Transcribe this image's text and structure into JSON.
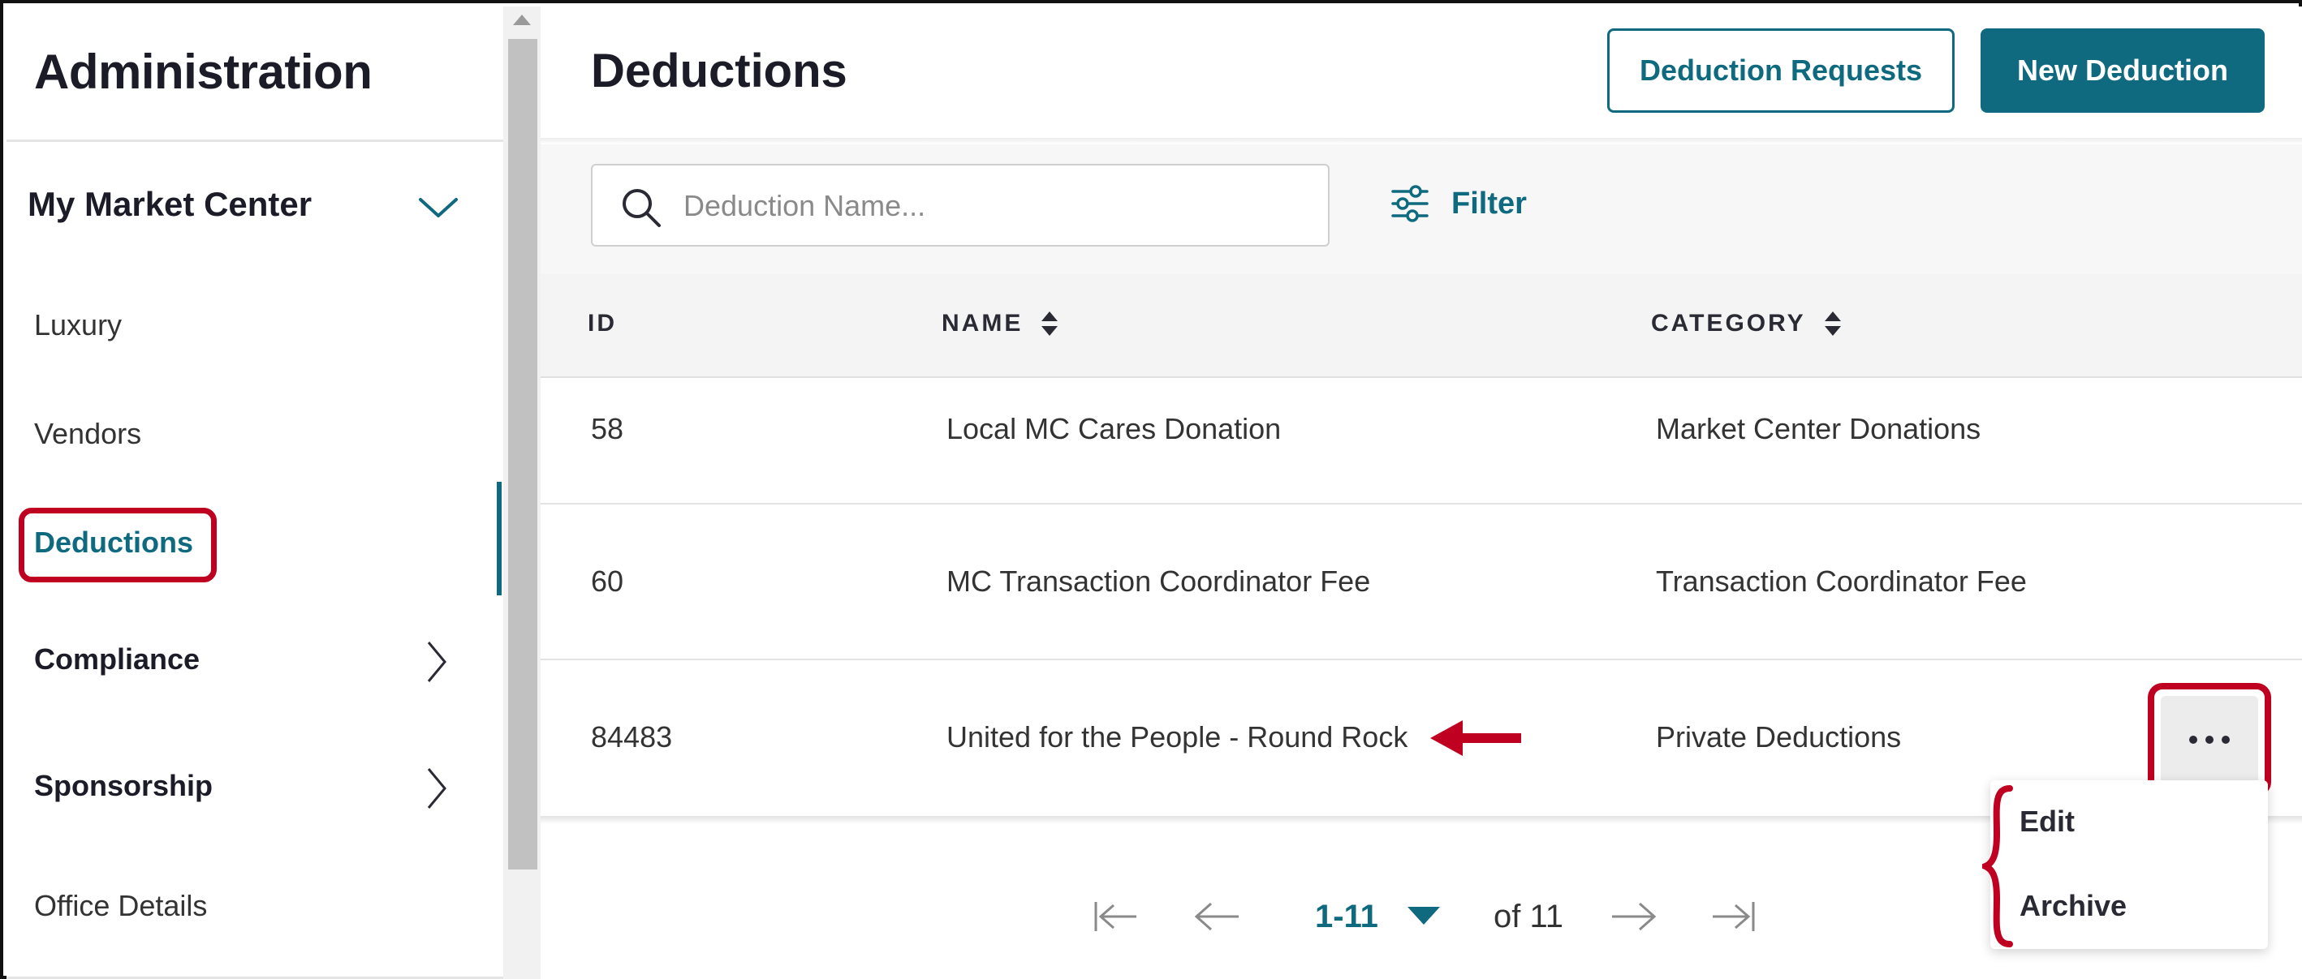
{
  "sidebar": {
    "title": "Administration",
    "group": "My Market Center",
    "items": [
      {
        "label": "Luxury"
      },
      {
        "label": "Vendors"
      },
      {
        "label": "Deductions"
      },
      {
        "label": "Compliance"
      },
      {
        "label": "Sponsorship"
      },
      {
        "label": "Office Details"
      }
    ]
  },
  "header": {
    "title": "Deductions",
    "requests_button": "Deduction Requests",
    "new_button": "New Deduction"
  },
  "toolbar": {
    "search_placeholder": "Deduction Name...",
    "filter_label": "Filter"
  },
  "table": {
    "columns": [
      "ID",
      "NAME",
      "CATEGORY"
    ],
    "rows": [
      {
        "id": "58",
        "name": "Local MC Cares Donation",
        "category": "Market Center Donations"
      },
      {
        "id": "60",
        "name": "MC Transaction Coordinator Fee",
        "category": "Transaction Coordinator Fee"
      },
      {
        "id": "84483",
        "name": "United for the People - Round Rock",
        "category": "Private Deductions"
      }
    ]
  },
  "row_menu": {
    "items": [
      "Edit",
      "Archive"
    ]
  },
  "pagination": {
    "range": "1-11",
    "of_text": "of 11"
  },
  "colors": {
    "accent": "#0f6a7f",
    "annotation": "#c00020"
  },
  "icons": [
    "chevron-down-icon",
    "chevron-right-icon",
    "search-icon",
    "filter-icon",
    "sort-icon",
    "more-icon",
    "first-page-icon",
    "prev-page-icon",
    "next-page-icon",
    "last-page-icon"
  ]
}
